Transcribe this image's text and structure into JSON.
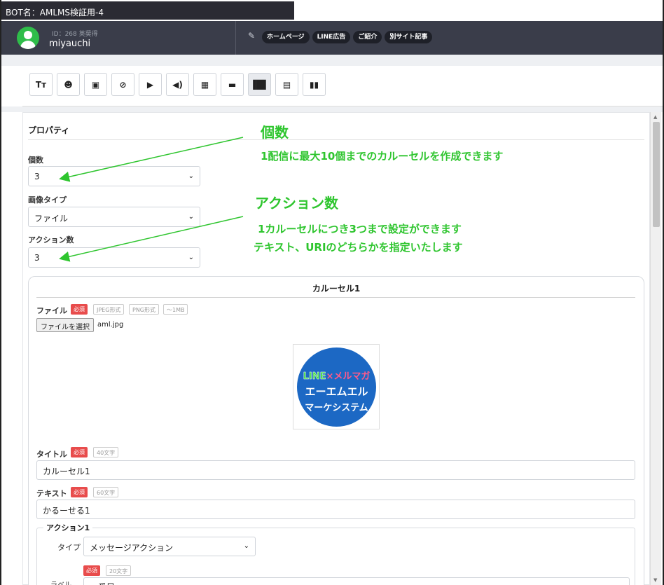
{
  "window": {
    "title": "BOT名：AMLMS検証用-4"
  },
  "user": {
    "id": "ID：268 英奨得",
    "name": "miyauchi"
  },
  "nav": {
    "pills": [
      "ホームページ",
      "LINE広告",
      "ご紹介",
      "別サイト記事"
    ]
  },
  "toolbar": {
    "tools": [
      {
        "name": "text-tool",
        "glyph": "Tт"
      },
      {
        "name": "emoji-tool",
        "glyph": "☻"
      },
      {
        "name": "image-tool",
        "glyph": "▣"
      },
      {
        "name": "link-tool",
        "glyph": "⊘"
      },
      {
        "name": "video-tool",
        "glyph": "▶"
      },
      {
        "name": "audio-tool",
        "glyph": "◀)"
      },
      {
        "name": "imagemap-tool",
        "glyph": "▦"
      },
      {
        "name": "button-tool",
        "glyph": "▬"
      },
      {
        "name": "carousel-tool",
        "glyph": "▐█▌"
      },
      {
        "name": "template-tool",
        "glyph": "▤"
      },
      {
        "name": "book-tool",
        "glyph": "▮▮"
      }
    ]
  },
  "properties": {
    "title": "プロパティ",
    "count": {
      "label": "個数",
      "value": "3"
    },
    "image_type": {
      "label": "画像タイプ",
      "value": "ファイル"
    },
    "action_count": {
      "label": "アクション数",
      "value": "3"
    }
  },
  "annotations": {
    "count_title": "個数",
    "count_desc": "1配信に最大10個までのカルーセルを作成できます",
    "action_title": "アクション数",
    "action_desc1": "1カルーセルにつき3つまで設定ができます",
    "action_desc2": "テキスト、URIのどちらかを指定いたします"
  },
  "carousel": {
    "heading": "カルーセル1",
    "file": {
      "label": "ファイル",
      "required": "必須",
      "tags": [
        "JPEG形式",
        "PNG形式",
        "～1MB"
      ],
      "button": "ファイルを選択",
      "filename": "aml.jpg"
    },
    "logo": {
      "line": "LINE",
      "x": "×",
      "mag": "メルマガ",
      "row2": "エーエムエル",
      "row3": "マーケシステム"
    },
    "title_field": {
      "label": "タイトル",
      "required": "必須",
      "limit": "40文字",
      "value": "カルーセル1"
    },
    "text_field": {
      "label": "テキスト",
      "required": "必須",
      "limit": "60文字",
      "value": "かるーせる1"
    },
    "action1": {
      "legend": "アクション1",
      "type_label": "タイプ",
      "type_value": "メッセージアクション",
      "required": "必須",
      "limit": "20文字",
      "label_text": "ラベル",
      "label_value": "一番目"
    }
  },
  "colors": {
    "annotation": "#2ec52e",
    "header": "#3a3d4a",
    "required_badge": "#e84c4c"
  }
}
